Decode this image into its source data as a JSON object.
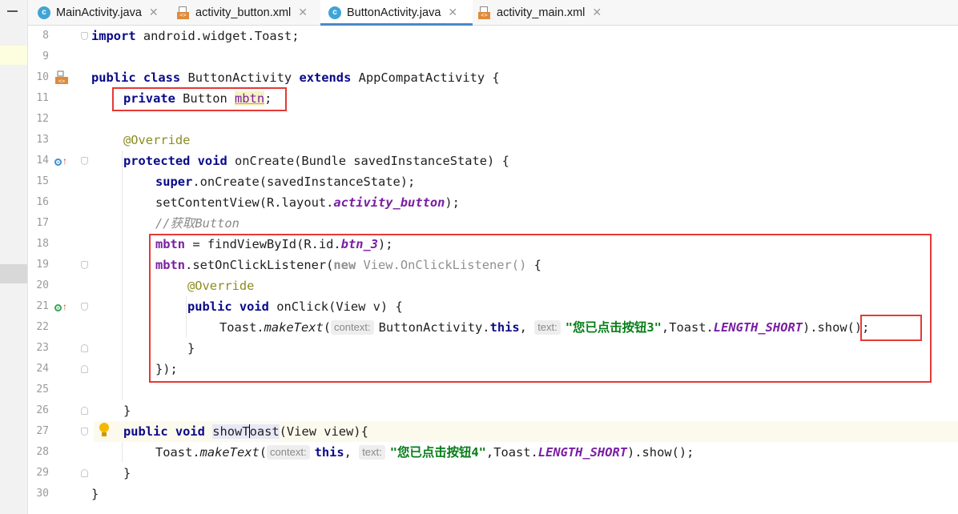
{
  "tabs": [
    {
      "label": "MainActivity.java",
      "type": "java",
      "active": false
    },
    {
      "label": "activity_button.xml",
      "type": "xml",
      "active": false
    },
    {
      "label": "ButtonActivity.java",
      "type": "java",
      "active": true
    },
    {
      "label": "activity_main.xml",
      "type": "xml",
      "active": false
    }
  ],
  "tab_icon_java": "c",
  "tab_icon_xml": "<>",
  "tab_close": "✕",
  "line_numbers": [
    "8",
    "9",
    "10",
    "11",
    "12",
    "13",
    "14",
    "15",
    "16",
    "17",
    "18",
    "19",
    "20",
    "21",
    "22",
    "23",
    "24",
    "25",
    "26",
    "27",
    "28",
    "29",
    "30"
  ],
  "code": {
    "l8_kw": "import",
    "l8_rest": " android.widget.Toast;",
    "l10_kw": "public class",
    "l10_mid": " ButtonActivity ",
    "l10_kw2": "extends",
    "l10_rest": " AppCompatActivity {",
    "l11_kw": "private",
    "l11_mid": " Button ",
    "l11_var": "mbtn",
    "l11_end": ";",
    "l13": "@Override",
    "l14_kw": "protected void",
    "l14_rest": " onCreate(Bundle savedInstanceState) {",
    "l15_kw": "super",
    "l15_rest": ".onCreate(savedInstanceState);",
    "l16_a": "setContentView(R.layout.",
    "l16_b": "activity_button",
    "l16_c": ");",
    "l17": "//获取Button",
    "l18_a": "mbtn",
    "l18_b": " = findViewById(R.id.",
    "l18_c": "btn_3",
    "l18_d": ");",
    "l19_a": "mbtn",
    "l19_b": ".setOnClickListener(",
    "l19_c": "new",
    "l19_d": " View.OnClickListener()",
    "l19_e": " {",
    "l20": "@Override",
    "l21_kw": "public void",
    "l21_rest": " onClick(View v) {",
    "l22_a": "Toast.",
    "l22_b": "makeText",
    "l22_c": "(",
    "l22_hint1": "context:",
    "l22_d": "ButtonActivity.",
    "l22_e": "this",
    "l22_f": ", ",
    "l22_hint2": "text:",
    "l22_str": "\"您已点击按钮3\"",
    "l22_g": ",Toast.",
    "l22_h": "LENGTH_SHORT",
    "l22_i": ").show();",
    "l23": "}",
    "l24": "});",
    "l26": "}",
    "l27_kw": "public void",
    "l27_sp": " ",
    "l27_name1": "showT",
    "l27_name2": "oast",
    "l27_rest": "(View view){",
    "l28_a": "Toast.",
    "l28_b": "makeText",
    "l28_c": "(",
    "l28_hint1": "context:",
    "l28_kw": "this",
    "l28_d": ", ",
    "l28_hint2": "text:",
    "l28_str": "\"您已点击按钮4\"",
    "l28_e": ",Toast.",
    "l28_f": "LENGTH_SHORT",
    "l28_g": ").show();",
    "l29": "}",
    "l30": "}"
  }
}
